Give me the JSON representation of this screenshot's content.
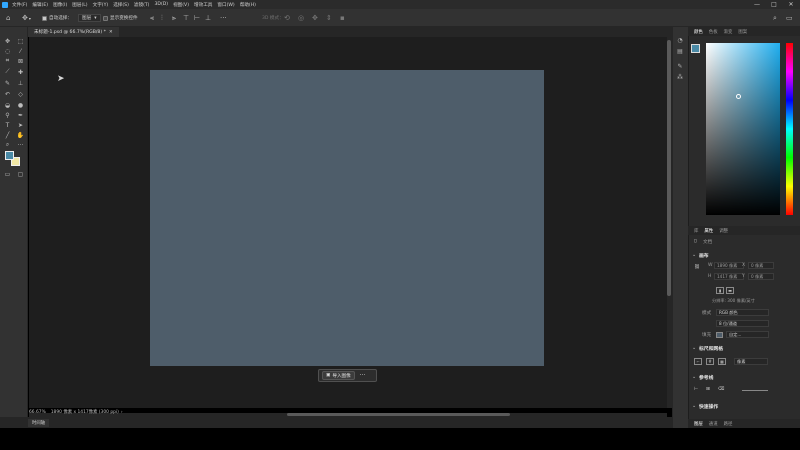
{
  "menubar": {
    "items": [
      "文件(F)",
      "编辑(E)",
      "图像(I)",
      "图层(L)",
      "文字(Y)",
      "选择(S)",
      "滤镜(T)",
      "3D(D)",
      "视图(V)",
      "增效工具",
      "窗口(W)",
      "帮助(H)"
    ],
    "window_controls": [
      "—",
      "□",
      "✕"
    ]
  },
  "options_bar": {
    "auto_select_label": "自动选择：",
    "auto_select_target": "图层",
    "show_transform_label": "显示变换控件",
    "mode_3d_label": "3D 模式："
  },
  "document_tab": {
    "title": "未标题-1.psd @ 66.7%(RGB/8) *",
    "close": "✕"
  },
  "canvas": {
    "background_color": "#4e5d6a",
    "workspace_color": "#1e1e1e"
  },
  "context_bar": {
    "import_label": "导入图像",
    "more_label": "···"
  },
  "status_bar": {
    "zoom": "66.67%",
    "doc_info": "1890 像素 x 1417像素 (300 ppi)",
    "bottom_tab": "时间轴"
  },
  "color_panel": {
    "fg_color": "#4a8aa6",
    "bg_color": "#f1e7a4",
    "field_hue": "#20aff0"
  },
  "properties_panel": {
    "tabs": [
      "库",
      "属性",
      "调整"
    ],
    "doc_label": "文档",
    "canvas_section": "画布",
    "width_label": "W",
    "width_value": "1890 像素",
    "height_label": "H",
    "height_value": "1417 像素",
    "x_label": "X",
    "x_value": "0 像素",
    "y_label": "Y",
    "y_value": "0 像素",
    "resolution": "分辨率: 300 像素/英寸",
    "mode_label": "模式",
    "mode_value": "RGB 颜色",
    "depth_value": "8 位/通道",
    "fill_label": "填充",
    "fill_value": "自定...",
    "rulers_section": "标尺和网格",
    "rulers_unit": "像素",
    "guides_section": "参考线",
    "quick_actions_section": "快速操作"
  },
  "bottom_panel_tabs": [
    "图层",
    "通道",
    "路径"
  ]
}
